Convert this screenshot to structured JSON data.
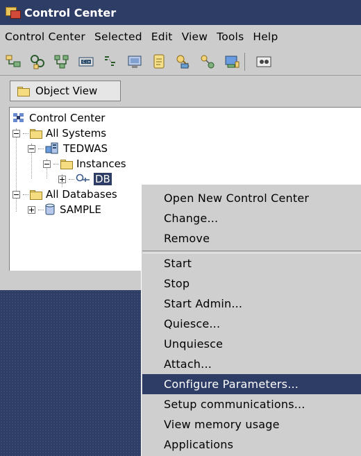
{
  "window": {
    "title": "Control Center"
  },
  "menubar": [
    "Control Center",
    "Selected",
    "Edit",
    "View",
    "Tools",
    "Help"
  ],
  "toolbar": {
    "icons": [
      "systems-icon",
      "instances-icon",
      "databases-icon",
      "command-center-icon",
      "script-center-icon",
      "journal-icon",
      "task-center-icon",
      "license-center-icon",
      "replication-icon",
      "development-center-icon",
      "show-hide-icon"
    ]
  },
  "object_view": {
    "label": "Object View"
  },
  "tree": {
    "root": "Control Center",
    "all_systems": "All Systems",
    "system": "TEDWAS",
    "instances": "Instances",
    "instance": "DB",
    "all_databases": "All Databases",
    "database": "SAMPLE"
  },
  "context_menu": {
    "group1": [
      "Open New Control Center",
      "Change...",
      "Remove"
    ],
    "group2": [
      "Start",
      "Stop",
      "Start Admin...",
      "Quiesce...",
      "Unquiesce",
      "Attach...",
      "Configure Parameters...",
      "Setup communications...",
      "View memory usage",
      "Applications"
    ],
    "highlighted": "Configure Parameters..."
  },
  "colors": {
    "selection": "#2e3d66",
    "background": "#cccccc",
    "menu": "#cfcfcf"
  }
}
